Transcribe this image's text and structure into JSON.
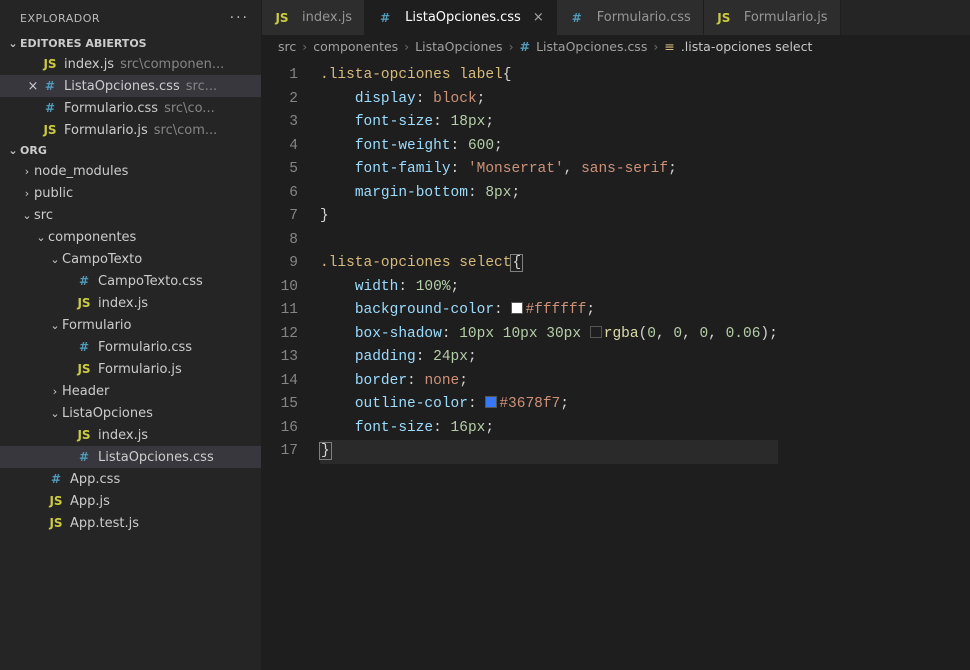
{
  "sidebar": {
    "title": "EXPLORADOR",
    "more": "···",
    "openEditors": {
      "header": "EDITORES ABIERTOS",
      "items": [
        {
          "icon": "JS",
          "name": "index.js",
          "path": "src\\componen..."
        },
        {
          "icon": "#",
          "name": "ListaOpciones.css",
          "path": "src..."
        },
        {
          "icon": "#",
          "name": "Formulario.css",
          "path": "src\\co..."
        },
        {
          "icon": "JS",
          "name": "Formulario.js",
          "path": "src\\com..."
        }
      ]
    },
    "project": {
      "header": "ORG",
      "tree": [
        {
          "depth": 0,
          "chev": "›",
          "icon": "",
          "name": "node_modules"
        },
        {
          "depth": 0,
          "chev": "›",
          "icon": "",
          "name": "public"
        },
        {
          "depth": 0,
          "chev": "⌄",
          "icon": "",
          "name": "src"
        },
        {
          "depth": 1,
          "chev": "⌄",
          "icon": "",
          "name": "componentes"
        },
        {
          "depth": 2,
          "chev": "⌄",
          "icon": "",
          "name": "CampoTexto"
        },
        {
          "depth": 3,
          "chev": "",
          "icon": "#",
          "iconClass": "ic-css",
          "name": "CampoTexto.css"
        },
        {
          "depth": 3,
          "chev": "",
          "icon": "JS",
          "iconClass": "ic-js",
          "name": "index.js"
        },
        {
          "depth": 2,
          "chev": "⌄",
          "icon": "",
          "name": "Formulario"
        },
        {
          "depth": 3,
          "chev": "",
          "icon": "#",
          "iconClass": "ic-css",
          "name": "Formulario.css"
        },
        {
          "depth": 3,
          "chev": "",
          "icon": "JS",
          "iconClass": "ic-js",
          "name": "Formulario.js"
        },
        {
          "depth": 2,
          "chev": "›",
          "icon": "",
          "name": "Header"
        },
        {
          "depth": 2,
          "chev": "⌄",
          "icon": "",
          "name": "ListaOpciones"
        },
        {
          "depth": 3,
          "chev": "",
          "icon": "JS",
          "iconClass": "ic-js",
          "name": "index.js"
        },
        {
          "depth": 3,
          "chev": "",
          "icon": "#",
          "iconClass": "ic-css",
          "name": "ListaOpciones.css",
          "selected": true
        },
        {
          "depth": 1,
          "chev": "",
          "icon": "#",
          "iconClass": "ic-css",
          "name": "App.css"
        },
        {
          "depth": 1,
          "chev": "",
          "icon": "JS",
          "iconClass": "ic-js",
          "name": "App.js"
        },
        {
          "depth": 1,
          "chev": "",
          "icon": "JS",
          "iconClass": "ic-js",
          "name": "App.test.js"
        }
      ]
    }
  },
  "tabs": [
    {
      "icon": "JS",
      "iconClass": "ic-js",
      "label": "index.js",
      "active": false
    },
    {
      "icon": "#",
      "iconClass": "ic-css",
      "label": "ListaOpciones.css",
      "active": true
    },
    {
      "icon": "#",
      "iconClass": "ic-css",
      "label": "Formulario.css",
      "active": false
    },
    {
      "icon": "JS",
      "iconClass": "ic-js",
      "label": "Formulario.js",
      "active": false
    }
  ],
  "breadcrumb": {
    "parts": [
      "src",
      "componentes",
      "ListaOpciones"
    ],
    "file": "ListaOpciones.css",
    "symbol": ".lista-opciones select",
    "sep": "›"
  },
  "code": {
    "lines": [
      {
        "n": 1,
        "t": [
          [
            "sel",
            ".lista-opciones label"
          ],
          [
            "punc",
            "{"
          ]
        ]
      },
      {
        "n": 2,
        "t": [
          [
            "ind",
            "    "
          ],
          [
            "prop",
            "display"
          ],
          [
            "punc",
            ": "
          ],
          [
            "val",
            "block"
          ],
          [
            "punc",
            ";"
          ]
        ]
      },
      {
        "n": 3,
        "t": [
          [
            "ind",
            "    "
          ],
          [
            "prop",
            "font-size"
          ],
          [
            "punc",
            ": "
          ],
          [
            "num",
            "18px"
          ],
          [
            "punc",
            ";"
          ]
        ]
      },
      {
        "n": 4,
        "t": [
          [
            "ind",
            "    "
          ],
          [
            "prop",
            "font-weight"
          ],
          [
            "punc",
            ": "
          ],
          [
            "num",
            "600"
          ],
          [
            "punc",
            ";"
          ]
        ]
      },
      {
        "n": 5,
        "t": [
          [
            "ind",
            "    "
          ],
          [
            "prop",
            "font-family"
          ],
          [
            "punc",
            ": "
          ],
          [
            "str",
            "'Monserrat'"
          ],
          [
            "punc",
            ", "
          ],
          [
            "val",
            "sans-serif"
          ],
          [
            "punc",
            ";"
          ]
        ]
      },
      {
        "n": 6,
        "t": [
          [
            "ind",
            "    "
          ],
          [
            "prop",
            "margin-bottom"
          ],
          [
            "punc",
            ": "
          ],
          [
            "num",
            "8px"
          ],
          [
            "punc",
            ";"
          ]
        ]
      },
      {
        "n": 7,
        "t": [
          [
            "punc",
            "}"
          ]
        ]
      },
      {
        "n": 8,
        "t": []
      },
      {
        "n": 9,
        "t": [
          [
            "sel",
            ".lista-opciones select"
          ],
          [
            "cursorbox",
            "{"
          ]
        ]
      },
      {
        "n": 10,
        "t": [
          [
            "ind",
            "    "
          ],
          [
            "prop",
            "width"
          ],
          [
            "punc",
            ": "
          ],
          [
            "num",
            "100%"
          ],
          [
            "punc",
            ";"
          ]
        ]
      },
      {
        "n": 11,
        "t": [
          [
            "ind",
            "    "
          ],
          [
            "prop",
            "background-color"
          ],
          [
            "punc",
            ": "
          ],
          [
            "swatch",
            "white"
          ],
          [
            "val",
            "#ffffff"
          ],
          [
            "punc",
            ";"
          ]
        ]
      },
      {
        "n": 12,
        "t": [
          [
            "ind",
            "    "
          ],
          [
            "prop",
            "box-shadow"
          ],
          [
            "punc",
            ": "
          ],
          [
            "num",
            "10px 10px 30px "
          ],
          [
            "swatch",
            "trans"
          ],
          [
            "fn",
            "rgba"
          ],
          [
            "punc",
            "("
          ],
          [
            "num",
            "0"
          ],
          [
            "punc",
            ", "
          ],
          [
            "num",
            "0"
          ],
          [
            "punc",
            ", "
          ],
          [
            "num",
            "0"
          ],
          [
            "punc",
            ", "
          ],
          [
            "num",
            "0.06"
          ],
          [
            "punc",
            ");"
          ]
        ]
      },
      {
        "n": 13,
        "t": [
          [
            "ind",
            "    "
          ],
          [
            "prop",
            "padding"
          ],
          [
            "punc",
            ": "
          ],
          [
            "num",
            "24px"
          ],
          [
            "punc",
            ";"
          ]
        ]
      },
      {
        "n": 14,
        "t": [
          [
            "ind",
            "    "
          ],
          [
            "prop",
            "border"
          ],
          [
            "punc",
            ": "
          ],
          [
            "val",
            "none"
          ],
          [
            "punc",
            ";"
          ]
        ]
      },
      {
        "n": 15,
        "t": [
          [
            "ind",
            "    "
          ],
          [
            "prop",
            "outline-color"
          ],
          [
            "punc",
            ": "
          ],
          [
            "swatch",
            "blue"
          ],
          [
            "val",
            "#3678f7"
          ],
          [
            "punc",
            ";"
          ]
        ]
      },
      {
        "n": 16,
        "t": [
          [
            "ind",
            "    "
          ],
          [
            "prop",
            "font-size"
          ],
          [
            "punc",
            ": "
          ],
          [
            "num",
            "16px"
          ],
          [
            "punc",
            ";"
          ]
        ]
      },
      {
        "n": 17,
        "t": [
          [
            "cursorbox",
            "}"
          ]
        ],
        "hl": true
      }
    ]
  }
}
